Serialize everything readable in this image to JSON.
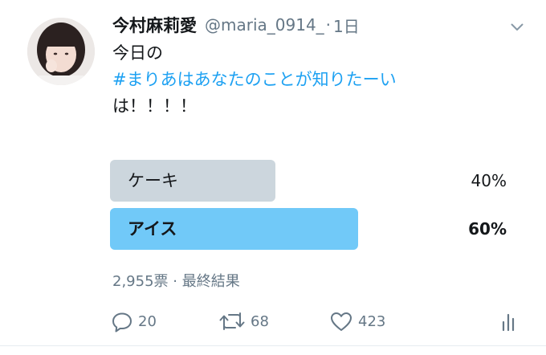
{
  "tweet": {
    "display_name": "今村麻莉愛",
    "handle": "@maria_0914_",
    "separator": "·",
    "time": "1日",
    "text_line1": "今日の",
    "hashtag": "#まりあはあなたのことが知りたーい",
    "text_line3": "は！！！！"
  },
  "poll": {
    "options": [
      {
        "label": "ケーキ",
        "percent_text": "40%",
        "percent": 40
      },
      {
        "label": "アイス",
        "percent_text": "60%",
        "percent": 60,
        "winner": true
      }
    ],
    "meta": "2,955票 · 最終結果"
  },
  "actions": {
    "reply_count": "20",
    "retweet_count": "68",
    "like_count": "423"
  },
  "icons": {
    "reply": "reply-icon",
    "retweet": "retweet-icon",
    "like": "heart-icon",
    "analytics": "analytics-icon",
    "caret": "chevron-down-icon"
  },
  "colors": {
    "hashtag": "#1da1f2",
    "poll_bar": "#ccd6dd",
    "poll_bar_winner": "#71c9f8",
    "secondary_text": "#657786"
  }
}
